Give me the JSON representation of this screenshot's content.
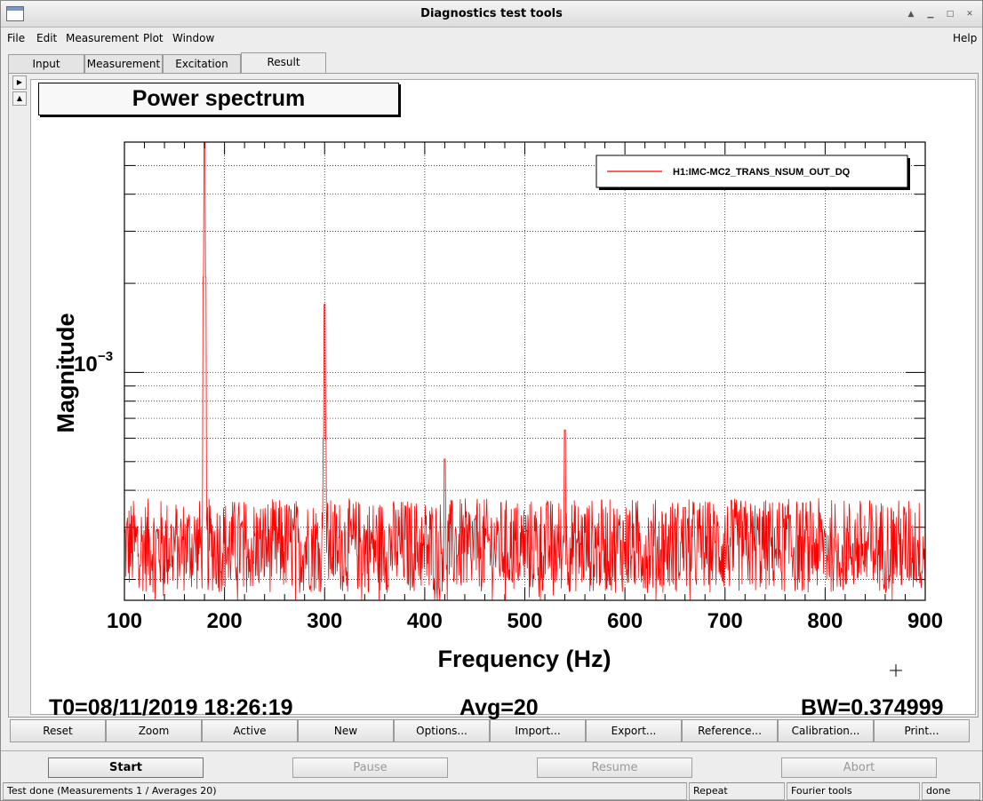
{
  "window": {
    "title": "Diagnostics test tools"
  },
  "menu": {
    "items": [
      "File",
      "Edit",
      "Measurement",
      "Plot",
      "Window"
    ],
    "help": "Help"
  },
  "tabs": [
    "Input",
    "Measurement",
    "Excitation",
    "Result"
  ],
  "active_tab": "Result",
  "plot": {
    "title": "Power spectrum",
    "ylabel": "Magnitude",
    "xlabel": "Frequency (Hz)",
    "legend": "H1:IMC-MC2_TRANS_NSUM_OUT_DQ",
    "ytick_base": "10",
    "ytick_exp": "−3",
    "t0": "T0=08/11/2019 18:26:19",
    "avg": "Avg=20",
    "bw": "BW=0.374999"
  },
  "chart_data": {
    "type": "line",
    "xlabel": "Frequency (Hz)",
    "ylabel": "Magnitude",
    "xlim": [
      100,
      900
    ],
    "ylim": [
      0.00017,
      0.006
    ],
    "yscale": "log",
    "grid": true,
    "legend_position": "top-right",
    "xticks": [
      100,
      200,
      300,
      400,
      500,
      600,
      700,
      800,
      900
    ],
    "series": [
      {
        "name": "H1:IMC-MC2_TRANS_NSUM_OUT_DQ",
        "color": "#ff0000",
        "noise_floor": 0.00026,
        "peaks": [
          {
            "x": 180,
            "y": 0.006
          },
          {
            "x": 300,
            "y": 0.0017
          },
          {
            "x": 420,
            "y": 0.00051
          },
          {
            "x": 540,
            "y": 0.00064
          },
          {
            "x": 660,
            "y": 0.00035
          },
          {
            "x": 765,
            "y": 0.00033
          }
        ]
      }
    ]
  },
  "buttons": [
    "Reset",
    "Zoom",
    "Active",
    "New",
    "Options...",
    "Import...",
    "Export...",
    "Reference...",
    "Calibration...",
    "Print..."
  ],
  "controls": {
    "start": "Start",
    "pause": "Pause",
    "resume": "Resume",
    "abort": "Abort"
  },
  "status": {
    "message": "Test done (Measurements 1 / Averages 20)",
    "mode": "Repeat",
    "tool": "Fourier tools",
    "state": "done"
  },
  "colors": {
    "trace": "#ff0000",
    "plot_bg": "#ffffff",
    "window_bg": "#ededed"
  }
}
